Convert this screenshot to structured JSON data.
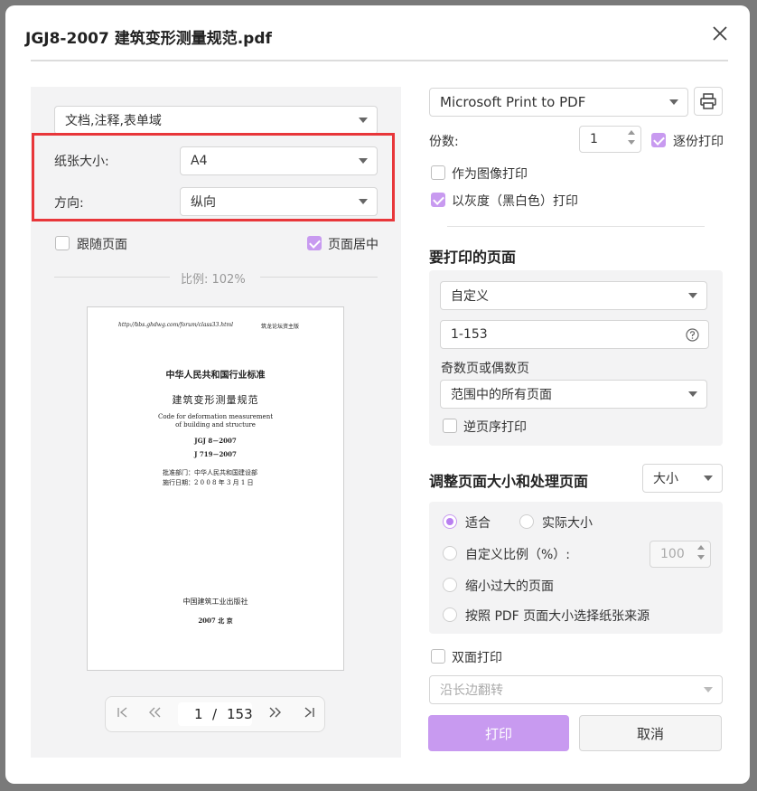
{
  "window": {
    "title": "JGJ8-2007 建筑变形测量规范.pdf"
  },
  "left": {
    "annotations_select": "文档,注释,表单域",
    "paper_size_label": "纸张大小:",
    "paper_size_value": "A4",
    "orientation_label": "方向:",
    "orientation_value": "纵向",
    "follow_page_label": "跟随页面",
    "center_page_label": "页面居中",
    "scale_text": "比例: 102%",
    "preview": {
      "header_left": "http://bbs.ghdwg.com/forum/class33.html",
      "header_right": "筑龙论坛资主版",
      "line1": "中华人民共和国行业标准",
      "line2": "建筑变形测量规范",
      "line3": "Code for deformation measurement",
      "line4": "of building and structure",
      "line5": "JGJ 8－2007",
      "line6": "J 719－2007",
      "line7": "批准部门：中华人民共和国建设部",
      "line8": "施行日期：2 0 0 8 年 3 月 1 日",
      "line9": "中国建筑工业出版社",
      "line10": "2007  北  京"
    },
    "pager": {
      "current": "1",
      "separator": "/",
      "total": "153"
    }
  },
  "right": {
    "printer": "Microsoft Print to PDF",
    "copies_label": "份数:",
    "copies_value": "1",
    "collate_label": "逐份打印",
    "print_as_image_label": "作为图像打印",
    "grayscale_label": "以灰度（黑白色）打印",
    "pages_section_title": "要打印的页面",
    "pages_mode": "自定义",
    "pages_range": "1-153",
    "odd_even_label": "奇数页或偶数页",
    "odd_even_value": "范围中的所有页面",
    "reverse_label": "逆页序打印",
    "resize_section_title": "调整页面大小和处理页面",
    "resize_mode": "大小",
    "fit_label": "适合",
    "actual_size_label": "实际大小",
    "custom_scale_label": "自定义比例（%）:",
    "custom_scale_value": "100",
    "shrink_label": "缩小过大的页面",
    "pdf_source_label": "按照 PDF 页面大小选择纸张来源",
    "duplex_label": "双面打印",
    "flip_value": "沿长边翻转",
    "print_button": "打印",
    "cancel_button": "取消"
  },
  "colors": {
    "accent": "#c89af0",
    "highlight_box": "#e8363a",
    "panel_bg": "#f3f3f4"
  }
}
